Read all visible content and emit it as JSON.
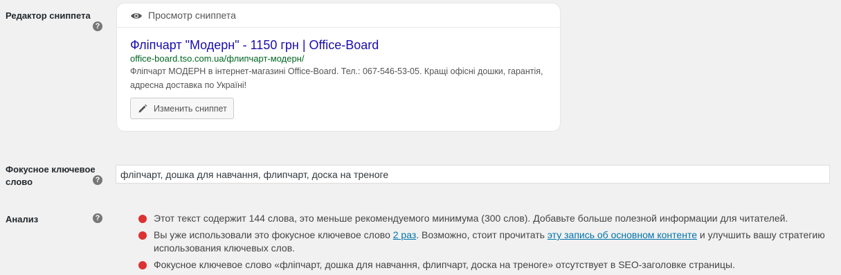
{
  "snippet_editor": {
    "label": "Редактор сниппета",
    "help": "?",
    "preview_heading": "Просмотр сниппета",
    "title": "Фліпчарт \"Модерн\" - 1150 грн | Office-Board",
    "url": "office-board.tso.com.ua/флипчарт-модерн/",
    "description": "Фліпчарт МОДЕРН в інтернет-магазині Office-Board. Тел.: 067-546-53-05. Кращі офісні дошки, гарантія, адресна доставка по Україні!",
    "edit_button": "Изменить сниппет"
  },
  "focus_keyword": {
    "label": "Фокусное ключевое слово",
    "help": "?",
    "value": "фліпчарт, дошка для навчання, флипчарт, доска на треноге"
  },
  "analysis": {
    "label": "Анализ",
    "help": "?",
    "status_color": "#dc3232",
    "items": [
      {
        "text": "Этот текст содержит 144 слова, это меньше рекомендуемого минимума (300 слов). Добавьте больше полезной информации для читателей."
      },
      {
        "pre": "Вы уже использовали это фокусное ключевое слово ",
        "link1": "2 раз",
        "mid": ". Возможно, стоит прочитать ",
        "link2": "эту запись об основном контенте",
        "post": " и улучшить вашу стратегию использования ключевых слов."
      },
      {
        "text": "Фокусное ключевое слово «фліпчарт, дошка для навчання, флипчарт, доска на треноге» отсутствует в SEO-заголовке страницы."
      }
    ]
  }
}
